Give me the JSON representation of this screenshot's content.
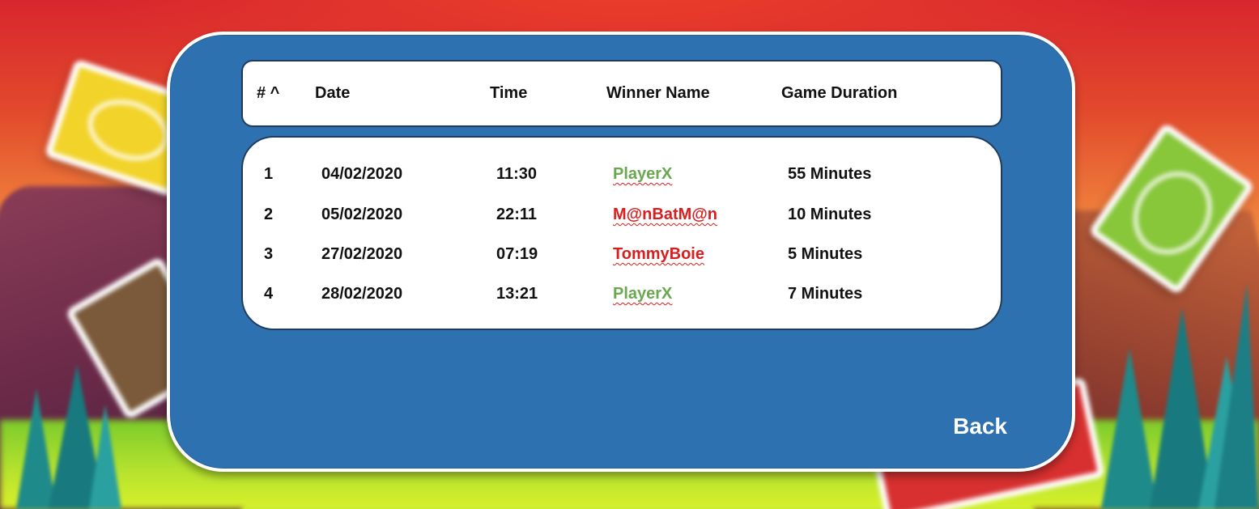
{
  "colors": {
    "panel": "#2e71b1",
    "winner_green": "#6aa84f",
    "winner_red": "#d81e1e"
  },
  "table": {
    "headers": {
      "num": "# ^",
      "date": "Date",
      "time": "Time",
      "winner": "Winner Name",
      "duration": "Game Duration"
    },
    "rows": [
      {
        "num": "1",
        "date": "04/02/2020",
        "time": "11:30",
        "winner": "PlayerX",
        "duration": "55 Minutes",
        "winner_color": "#6aa84f"
      },
      {
        "num": "2",
        "date": "05/02/2020",
        "time": "22:11",
        "winner": "M@nBatM@n",
        "duration": "10 Minutes",
        "winner_color": "#d81e1e"
      },
      {
        "num": "3",
        "date": "27/02/2020",
        "time": "07:19",
        "winner": "TommyBoie",
        "duration": "5 Minutes",
        "winner_color": "#d81e1e"
      },
      {
        "num": "4",
        "date": "28/02/2020",
        "time": "13:21",
        "winner": "PlayerX",
        "duration": "7 Minutes",
        "winner_color": "#6aa84f"
      }
    ]
  },
  "back_label": "Back"
}
